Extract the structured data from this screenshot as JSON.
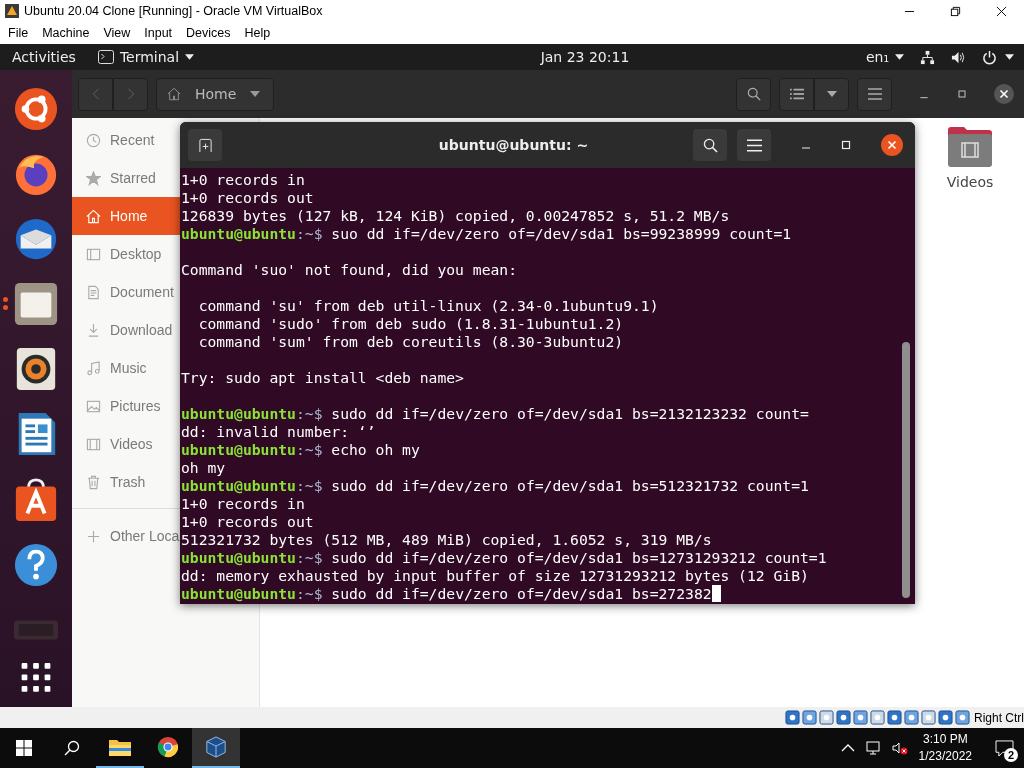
{
  "vbox": {
    "title": "Ubuntu 20.04 Clone [Running] - Oracle VM VirtualBox",
    "menu": [
      "File",
      "Machine",
      "View",
      "Input",
      "Devices",
      "Help"
    ],
    "host_key": "Right Ctrl"
  },
  "topbar": {
    "activities": "Activities",
    "app": "Terminal",
    "clock": "Jan 23  20:11",
    "input_source": "en₁"
  },
  "dock": [
    {
      "kind": "ubuntu",
      "running": false
    },
    {
      "kind": "firefox",
      "running": false
    },
    {
      "kind": "thunderbird",
      "running": false
    },
    {
      "kind": "files",
      "running": true
    },
    {
      "kind": "rhythmbox",
      "running": false
    },
    {
      "kind": "writer",
      "running": false
    },
    {
      "kind": "software",
      "running": false
    },
    {
      "kind": "help",
      "running": false
    },
    {
      "kind": "terminal",
      "running": false
    }
  ],
  "files": {
    "location": "Home",
    "sidebar": [
      {
        "kind": "recent",
        "label": "Recent",
        "selected": false
      },
      {
        "kind": "starred",
        "label": "Starred",
        "selected": false
      },
      {
        "kind": "home",
        "label": "Home",
        "selected": true
      },
      {
        "kind": "desktop",
        "label": "Desktop",
        "selected": false
      },
      {
        "kind": "documents",
        "label": "Document",
        "selected": false
      },
      {
        "kind": "downloads",
        "label": "Download",
        "selected": false
      },
      {
        "kind": "music",
        "label": "Music",
        "selected": false
      },
      {
        "kind": "pictures",
        "label": "Pictures",
        "selected": false
      },
      {
        "kind": "videos",
        "label": "Videos",
        "selected": false
      },
      {
        "kind": "trash",
        "label": "Trash",
        "selected": false
      },
      {
        "kind": "other",
        "label": "Other Loca",
        "selected": false
      }
    ],
    "folders": [
      {
        "label": "Videos"
      }
    ]
  },
  "terminal": {
    "title": "ubuntu@ubuntu: ~",
    "lines": [
      {
        "kind": "output",
        "text": "1+0 records in"
      },
      {
        "kind": "output",
        "text": "1+0 records out"
      },
      {
        "kind": "output",
        "text": "126839 bytes (127 kB, 124 KiB) copied, 0.00247852 s, 51.2 MB/s"
      },
      {
        "kind": "prompt",
        "user": "ubuntu@ubuntu",
        "path": ":~$",
        "command": "suo dd if=/dev/zero of=/dev/sda1 bs=99238999 count=1",
        "cursor": false
      },
      {
        "kind": "blank"
      },
      {
        "kind": "output",
        "text": "Command 'suo' not found, did you mean:"
      },
      {
        "kind": "blank"
      },
      {
        "kind": "output",
        "text": "  command 'su' from deb util-linux (2.34-0.1ubuntu9.1)"
      },
      {
        "kind": "output",
        "text": "  command 'sudo' from deb sudo (1.8.31-1ubuntu1.2)"
      },
      {
        "kind": "output",
        "text": "  command 'sum' from deb coreutils (8.30-3ubuntu2)"
      },
      {
        "kind": "blank"
      },
      {
        "kind": "output",
        "text": "Try: sudo apt install <deb name>"
      },
      {
        "kind": "blank"
      },
      {
        "kind": "prompt",
        "user": "ubuntu@ubuntu",
        "path": ":~$",
        "command": "sudo dd if=/dev/zero of=/dev/sda1 bs=2132123232 count=",
        "cursor": false
      },
      {
        "kind": "output",
        "text": "dd: invalid number: ‘’"
      },
      {
        "kind": "prompt",
        "user": "ubuntu@ubuntu",
        "path": ":~$",
        "command": "echo oh my",
        "cursor": false
      },
      {
        "kind": "output",
        "text": "oh my"
      },
      {
        "kind": "prompt",
        "user": "ubuntu@ubuntu",
        "path": ":~$",
        "command": "sudo dd if=/dev/zero of=/dev/sda1 bs=512321732 count=1",
        "cursor": false
      },
      {
        "kind": "output",
        "text": "1+0 records in"
      },
      {
        "kind": "output",
        "text": "1+0 records out"
      },
      {
        "kind": "output",
        "text": "512321732 bytes (512 MB, 489 MiB) copied, 1.6052 s, 319 MB/s"
      },
      {
        "kind": "prompt",
        "user": "ubuntu@ubuntu",
        "path": ":~$",
        "command": "sudo dd if=/dev/zero of=/dev/sda1 bs=12731293212 count=1",
        "cursor": false
      },
      {
        "kind": "output",
        "text": "dd: memory exhausted by input buffer of size 12731293212 bytes (12 GiB)"
      },
      {
        "kind": "prompt",
        "user": "ubuntu@ubuntu",
        "path": ":~$",
        "command": "sudo dd if=/dev/zero of=/dev/sda1 bs=272382",
        "cursor": true
      }
    ]
  },
  "taskbar": {
    "apps": [
      {
        "kind": "explorer",
        "running": true,
        "selected": false
      },
      {
        "kind": "chrome",
        "running": false,
        "selected": false
      },
      {
        "kind": "virtualbox",
        "running": true,
        "selected": true
      }
    ],
    "time": "3:10 PM",
    "date": "1/23/2022",
    "notifications": "2"
  }
}
